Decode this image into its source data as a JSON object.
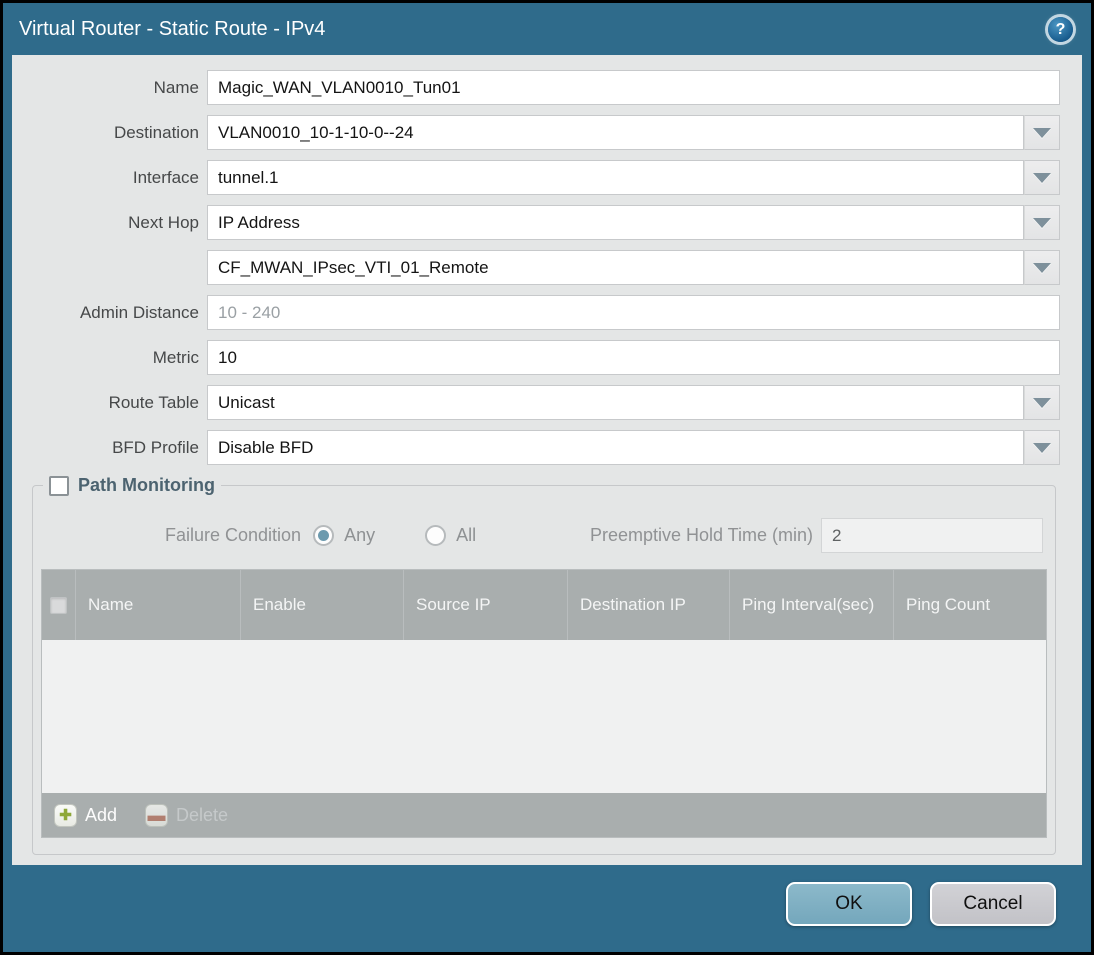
{
  "dialog": {
    "title": "Virtual Router - Static Route - IPv4",
    "help_glyph": "?"
  },
  "form": {
    "fields": [
      {
        "label": "Name",
        "value": "Magic_WAN_VLAN0010_Tun01"
      },
      {
        "label": "Destination",
        "value": "VLAN0010_10-1-10-0--24"
      },
      {
        "label": "Interface",
        "value": "tunnel.1"
      },
      {
        "label": "Next Hop",
        "value": "IP Address"
      },
      {
        "label": "",
        "value": "CF_MWAN_IPsec_VTI_01_Remote"
      },
      {
        "label": "Admin Distance",
        "value": "",
        "placeholder": "10 - 240"
      },
      {
        "label": "Metric",
        "value": "10"
      },
      {
        "label": "Route Table",
        "value": "Unicast"
      },
      {
        "label": "BFD Profile",
        "value": "Disable BFD"
      }
    ]
  },
  "path_monitoring": {
    "title": "Path Monitoring",
    "checkbox_checked": false,
    "failure_condition_label": "Failure Condition",
    "options": [
      {
        "label": "Any",
        "selected": true
      },
      {
        "label": "All",
        "selected": false
      }
    ],
    "preemptive_label": "Preemptive Hold Time (min)",
    "preemptive_value": "2"
  },
  "table": {
    "columns": [
      "Name",
      "Enable",
      "Source IP",
      "Destination IP",
      "Ping Interval(sec)",
      "Ping Count"
    ],
    "rows": []
  },
  "table_toolbar": {
    "add_label": "Add",
    "add_icon_glyph": "✚",
    "delete_label": "Delete",
    "delete_icon_glyph": "▬",
    "delete_enabled": false
  },
  "footer": {
    "ok_label": "OK",
    "cancel_label": "Cancel"
  },
  "colors": {
    "frame_teal": "#2f6b8b",
    "content_bg": "#e4e6e6",
    "table_header_gray": "#a9aeae",
    "ok_button_blue": "#7fb0c3",
    "cancel_button_gray": "#c9c9cd",
    "selected_radio_fill": "#6c9aae",
    "pm_title_color": "#4c6370",
    "add_plus_green": "#8ea839",
    "delete_minus_red": "#b4705c"
  }
}
